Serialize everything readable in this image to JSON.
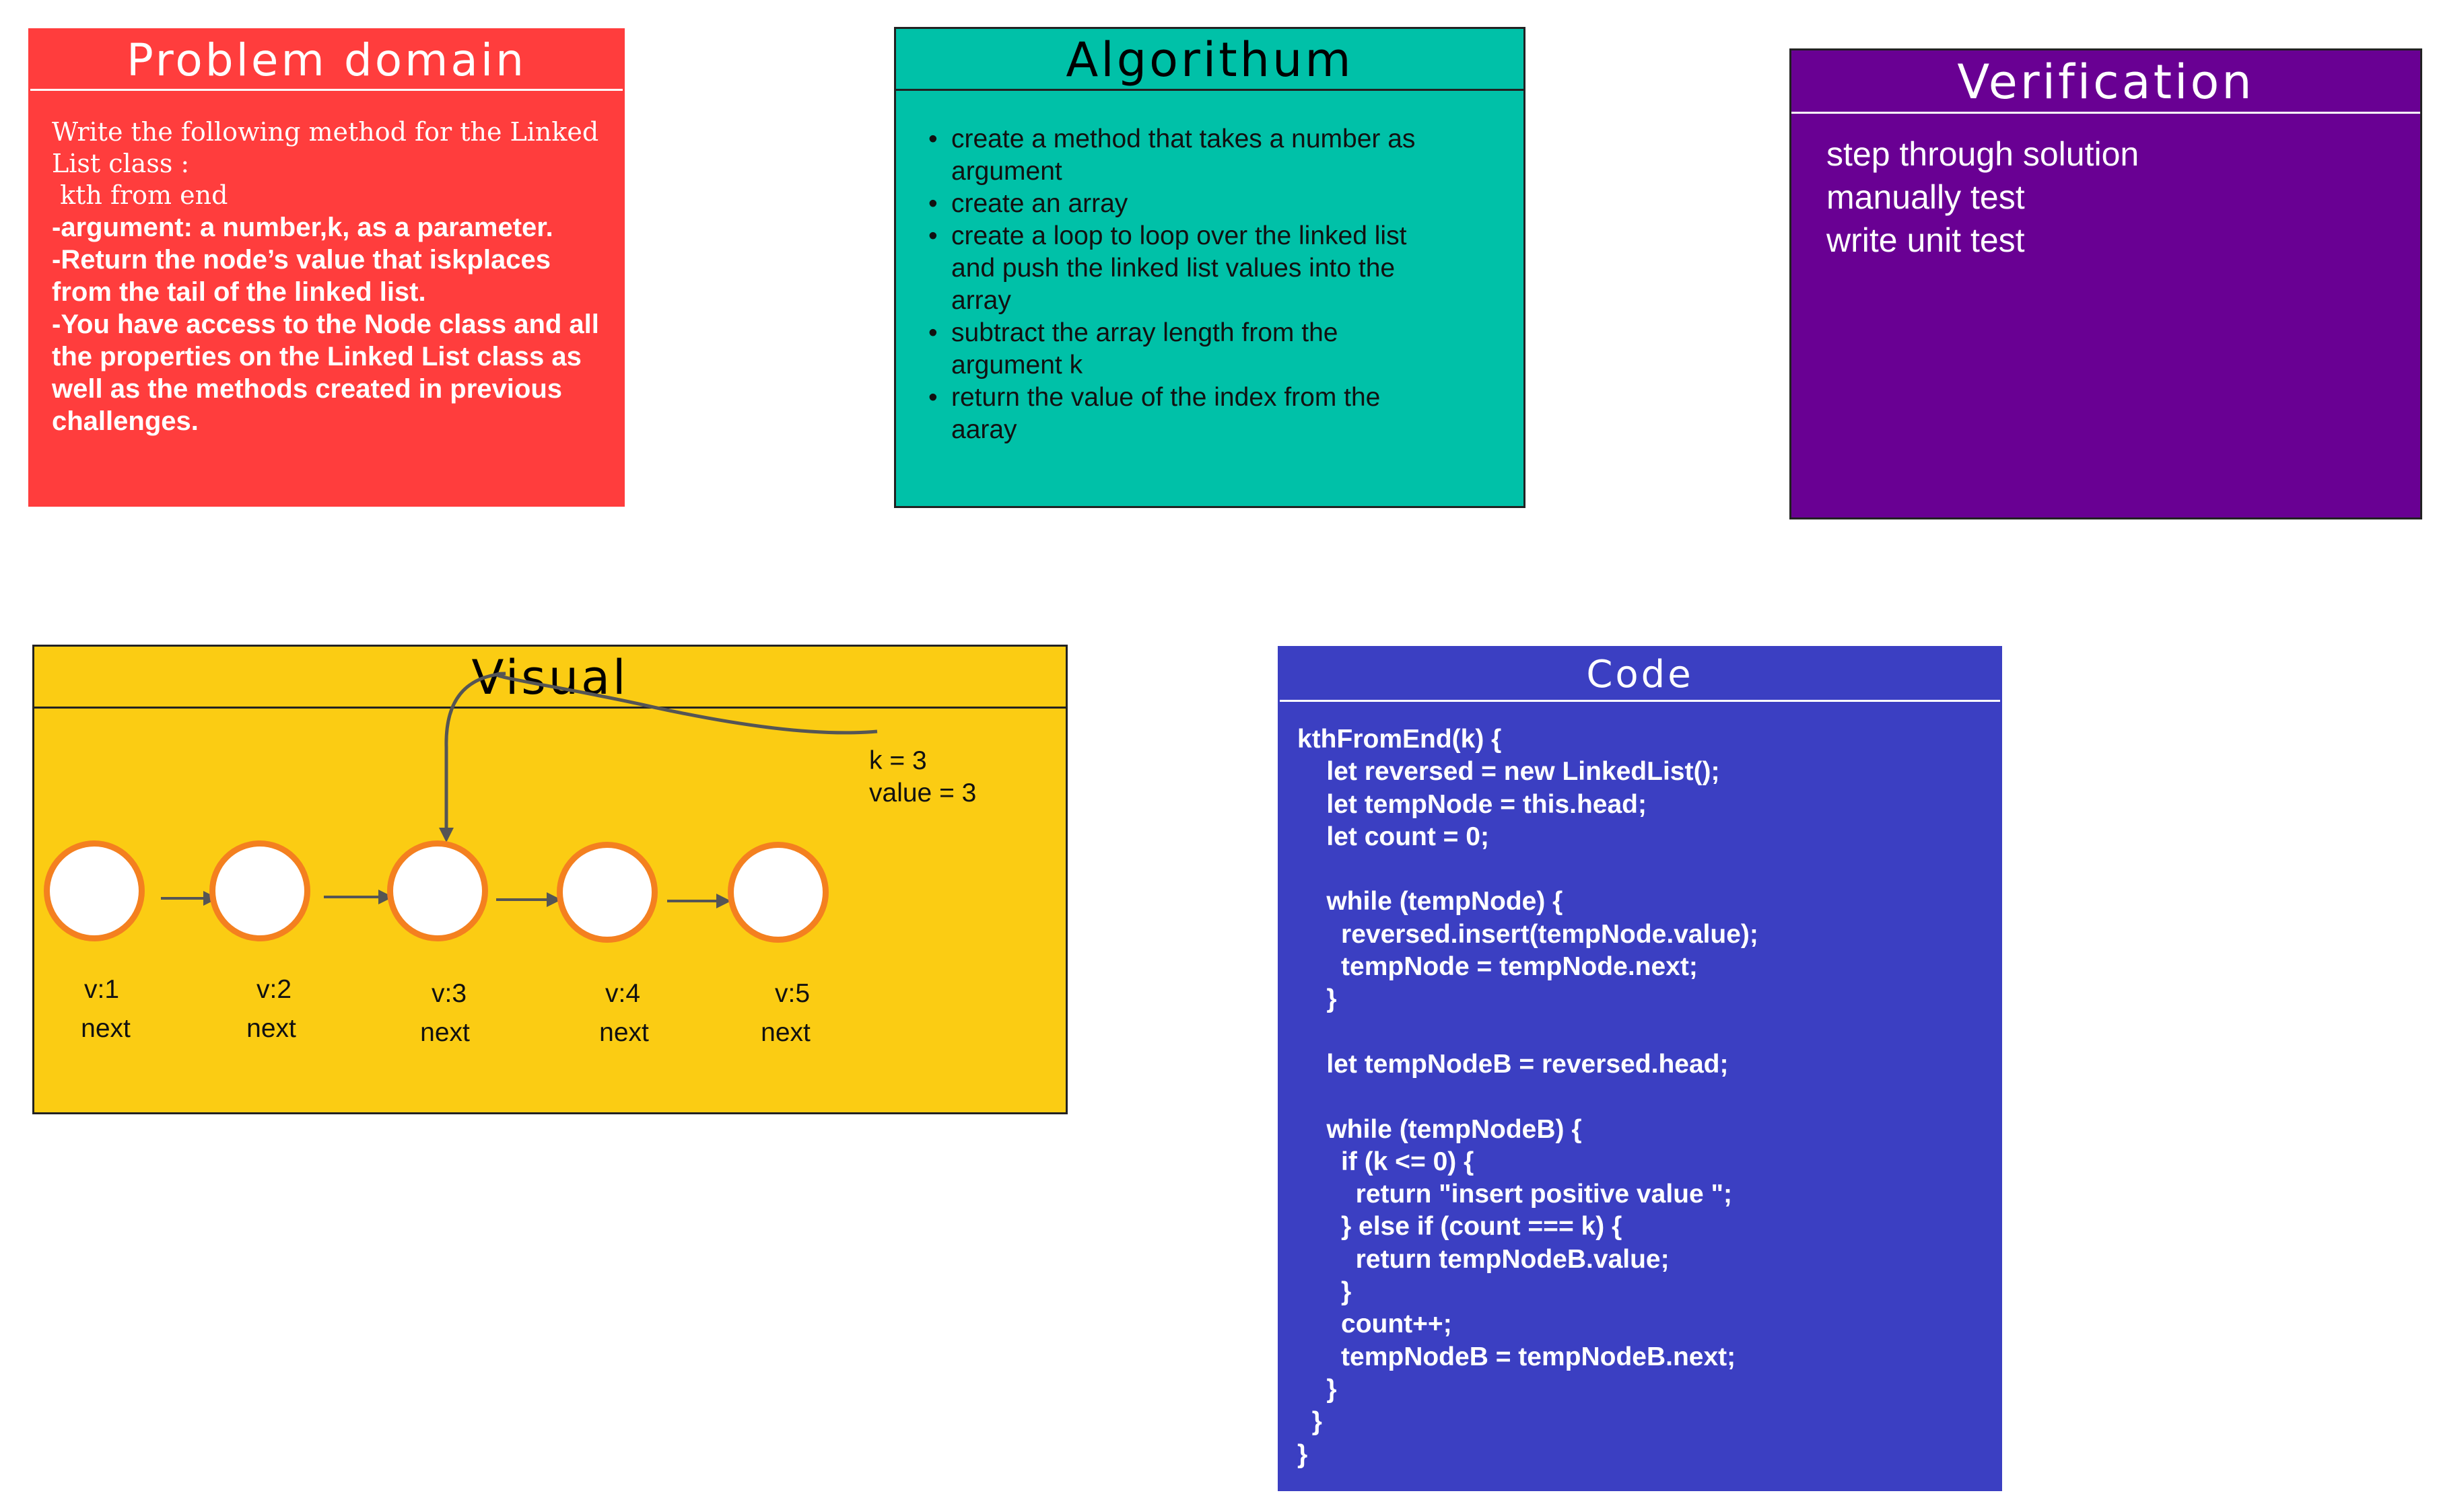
{
  "problem": {
    "title": "Problem domain",
    "intro": "Write the following method for the Linked List class :\n kth from end",
    "lines": [
      "-argument: a number,k, as a parameter.",
      "-Return the node’s value that iskplaces from the tail of the linked list.",
      "-You have access to the Node class and all the properties on the Linked List class as well as the methods created in previous challenges."
    ]
  },
  "algorithm": {
    "title": "Algorithum",
    "items": [
      "create a method that takes a number as argument",
      "create an array",
      "create a loop to loop over the linked list and push the linked list values into the array",
      "subtract the array length from the argument k",
      "return the value of the index from the aaray"
    ]
  },
  "verification": {
    "title": "Verification",
    "items": [
      "step through solution",
      "manually test",
      "write unit test"
    ]
  },
  "visual": {
    "title": "Visual",
    "note_k": "k = 3",
    "note_value": "value = 3",
    "nodes": [
      {
        "value": "v:1",
        "next": "next"
      },
      {
        "value": "v:2",
        "next": "next"
      },
      {
        "value": "v:3",
        "next": "next"
      },
      {
        "value": "v:4",
        "next": "next"
      },
      {
        "value": "v:5",
        "next": "next"
      }
    ],
    "colors": {
      "node_border": "#f4801f",
      "arrow": "#555555",
      "background": "#fbcc13"
    }
  },
  "code": {
    "title": "Code",
    "text": "kthFromEnd(k) {\n    let reversed = new LinkedList();\n    let tempNode = this.head;\n    let count = 0;\n\n    while (tempNode) {\n      reversed.insert(tempNode.value);\n      tempNode = tempNode.next;\n    }\n\n    let tempNodeB = reversed.head;\n\n    while (tempNodeB) {\n      if (k <= 0) {\n        return \"insert positive value \";\n      } else if (count === k) {\n        return tempNodeB.value;\n      }\n      count++;\n      tempNodeB = tempNodeB.next;\n    }\n  }\n}"
  },
  "colors": {
    "problem": "#ff3d3d",
    "algorithm": "#00c1a8",
    "verification": "#690093",
    "visual": "#fbcc13",
    "code": "#3b3fc2"
  }
}
